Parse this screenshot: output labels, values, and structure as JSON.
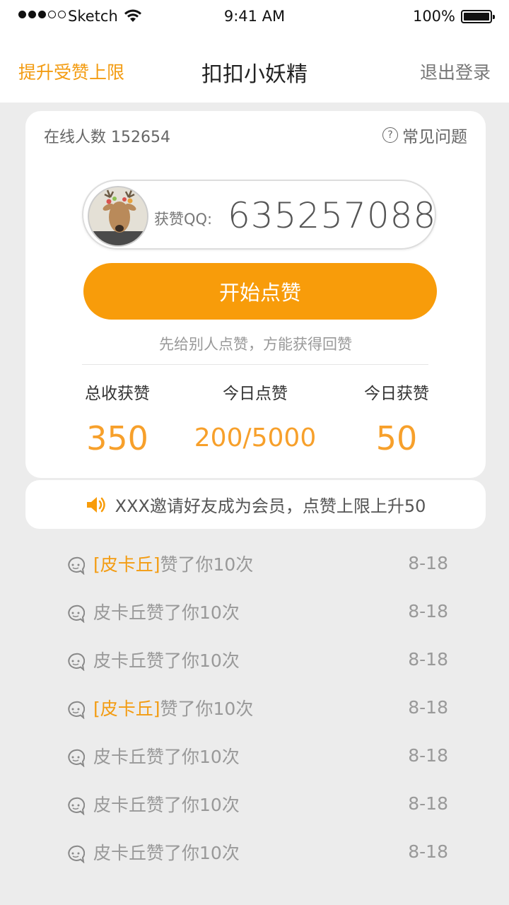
{
  "status_bar": {
    "carrier": "Sketch",
    "time": "9:41 AM",
    "battery": "100%"
  },
  "nav": {
    "left_label": "提升受赞上限",
    "title": "扣扣小妖精",
    "right_label": "退出登录"
  },
  "card": {
    "online_label": "在线人数",
    "online_count": "152654",
    "faq_label": "常见问题",
    "qq_label": "获赞QQ:",
    "qq_number": "635257088",
    "start_button": "开始点赞",
    "tip": "先给别人点赞，方能获得回赞",
    "stats": [
      {
        "label": "总收获赞",
        "value": "350"
      },
      {
        "label": "今日点赞",
        "value": "200/5000"
      },
      {
        "label": "今日获赞",
        "value": "50"
      }
    ]
  },
  "notice": {
    "text": "XXX邀请好友成为会员，点赞上限上升50"
  },
  "feed": [
    {
      "highlight": "[皮卡丘]",
      "name": "",
      "text": "赞了你10次",
      "date": "8-18"
    },
    {
      "highlight": "",
      "name": "皮卡丘",
      "text": "赞了你10次",
      "date": "8-18"
    },
    {
      "highlight": "",
      "name": "皮卡丘",
      "text": "赞了你10次",
      "date": "8-18"
    },
    {
      "highlight": "[皮卡丘]",
      "name": "",
      "text": "赞了你10次",
      "date": "8-18"
    },
    {
      "highlight": "",
      "name": "皮卡丘",
      "text": "赞了你10次",
      "date": "8-18"
    },
    {
      "highlight": "",
      "name": "皮卡丘",
      "text": "赞了你10次",
      "date": "8-18"
    },
    {
      "highlight": "",
      "name": "皮卡丘",
      "text": "赞了你10次",
      "date": "8-18"
    }
  ],
  "colors": {
    "accent": "#f89c0a",
    "highlight": "#f39c12",
    "background": "#ececec"
  }
}
